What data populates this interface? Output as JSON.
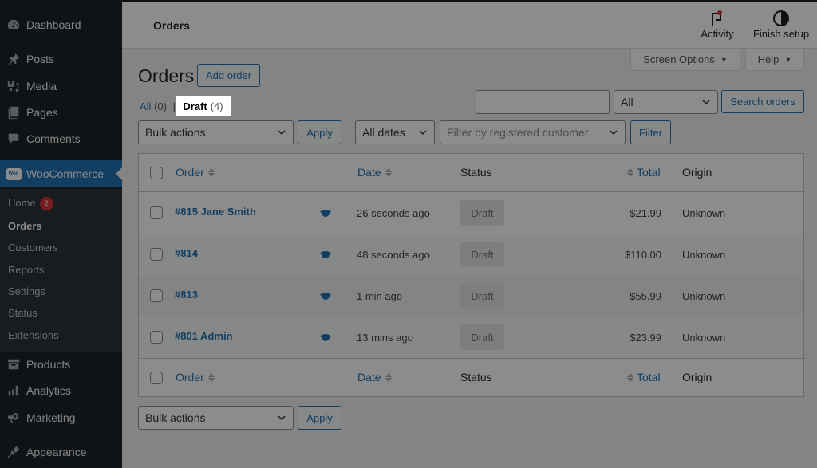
{
  "sidebar": {
    "items": [
      {
        "label": "Dashboard",
        "icon": "dashboard-icon"
      },
      {
        "label": "Posts",
        "icon": "pushpin-icon"
      },
      {
        "label": "Media",
        "icon": "media-icon"
      },
      {
        "label": "Pages",
        "icon": "pages-icon"
      },
      {
        "label": "Comments",
        "icon": "comment-icon"
      },
      {
        "label": "WooCommerce",
        "icon": "woo-icon",
        "active": true
      },
      {
        "label": "Products",
        "icon": "archive-box-icon"
      },
      {
        "label": "Analytics",
        "icon": "bar-chart-icon"
      },
      {
        "label": "Marketing",
        "icon": "megaphone-icon"
      },
      {
        "label": "Appearance",
        "icon": "paintbrush-icon"
      }
    ],
    "woo_logo_text": "Woo",
    "submenu": [
      {
        "label": "Home",
        "badge": "2"
      },
      {
        "label": "Orders",
        "current": true
      },
      {
        "label": "Customers"
      },
      {
        "label": "Reports"
      },
      {
        "label": "Settings"
      },
      {
        "label": "Status"
      },
      {
        "label": "Extensions"
      }
    ]
  },
  "header": {
    "title": "Orders",
    "activity_label": "Activity",
    "finish_setup_label": "Finish setup",
    "screen_options_label": "Screen Options",
    "help_label": "Help",
    "activity_notification_color": "#d63638"
  },
  "page": {
    "title": "Orders",
    "add_order_label": "Add order",
    "views": [
      {
        "label": "All",
        "count": "(0)",
        "separator": "|"
      },
      {
        "label": "Draft",
        "count": "(4)",
        "current": true
      }
    ],
    "search": {
      "value": "",
      "scope_selected": "All",
      "button_label": "Search orders"
    },
    "filters": {
      "bulk_actions": "Bulk actions",
      "apply_label": "Apply",
      "dates_selected": "All dates",
      "customer_placeholder": "Filter by registered customer",
      "filter_label": "Filter"
    },
    "bottom": {
      "bulk_actions": "Bulk actions",
      "apply_label": "Apply"
    }
  },
  "table": {
    "columns": {
      "order": "Order",
      "date": "Date",
      "status": "Status",
      "total": "Total",
      "origin": "Origin"
    },
    "rows": [
      {
        "order": "#815 Jane Smith",
        "date": "26 seconds ago",
        "status": "Draft",
        "total": "$21.99",
        "origin": "Unknown"
      },
      {
        "order": "#814",
        "date": "48 seconds ago",
        "status": "Draft",
        "total": "$110.00",
        "origin": "Unknown"
      },
      {
        "order": "#813",
        "date": "1 min ago",
        "status": "Draft",
        "total": "$55.99",
        "origin": "Unknown"
      },
      {
        "order": "#801 Admin",
        "date": "13 mins ago",
        "status": "Draft",
        "total": "$23.99",
        "origin": "Unknown"
      }
    ]
  },
  "colors": {
    "accent": "#2271b1",
    "sidebar_bg": "#1d2327",
    "overlay": "rgba(0,0,0,0.45)"
  }
}
